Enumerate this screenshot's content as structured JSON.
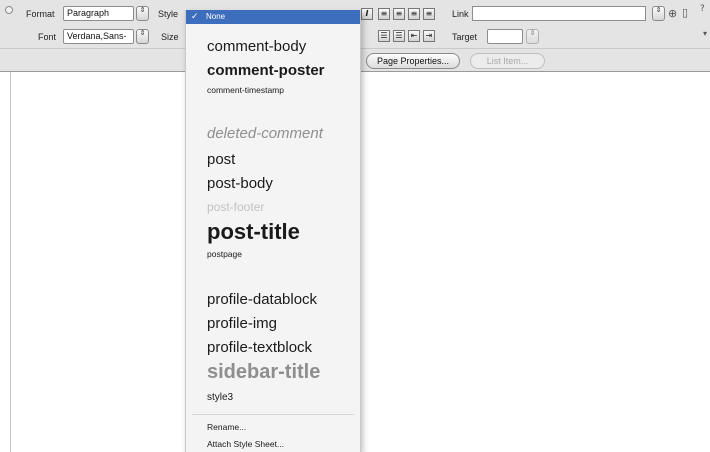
{
  "inspector": {
    "format_label": "Format",
    "format_value": "Paragraph",
    "style_label": "Style",
    "font_label": "Font",
    "font_value": "Verdana,Sans-",
    "size_label": "Size",
    "link_label": "Link",
    "link_value": "",
    "target_label": "Target",
    "target_value": "",
    "page_properties_button": "Page Properties...",
    "list_item_button": "List Item...",
    "italic_glyph": "I",
    "align_left_glyph": "≡",
    "align_center_glyph": "≡",
    "align_right_glyph": "≡",
    "align_justify_glyph": "≡",
    "unordered_list_glyph": "☰",
    "ordered_list_glyph": "☰",
    "outdent_glyph": "⇤",
    "indent_glyph": "⇥",
    "stepper_glyph": "⇕"
  },
  "style_menu": {
    "selected": "None",
    "check_glyph": "✓",
    "items": [
      "comment-body",
      "comment-poster",
      "comment-timestamp",
      "deleted-comment",
      "post",
      "post-body",
      "post-footer",
      "post-title",
      "postpage",
      "profile-datablock",
      "profile-img",
      "profile-textblock",
      "sidebar-title",
      "style3"
    ],
    "rename": "Rename...",
    "attach": "Attach Style Sheet..."
  },
  "colors": {
    "menu_highlight": "#3d6dbd",
    "panel_bg": "#e4e4e4",
    "menu_bg": "#f4f4f4"
  }
}
